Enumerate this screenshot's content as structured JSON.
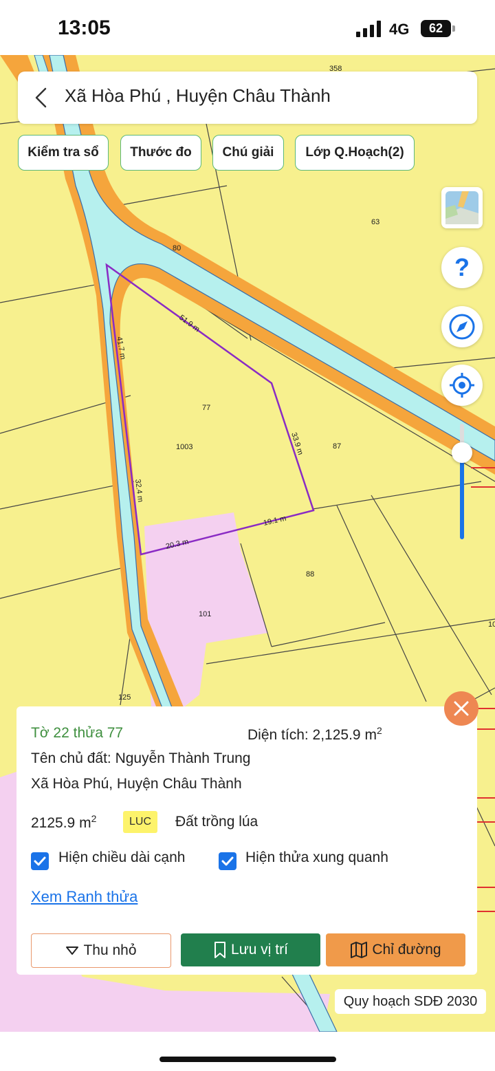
{
  "status": {
    "time": "13:05",
    "network": "4G",
    "battery": "62"
  },
  "header": {
    "title": "Xã Hòa Phú , Huyện Châu Thành"
  },
  "toolbar": {
    "buttons": [
      "Kiểm tra sổ",
      "Thước đo",
      "Chú giải",
      "Lớp Q.Hoạch(2)"
    ]
  },
  "map": {
    "parcel_numbers": [
      "358",
      "63",
      "80",
      "77",
      "1003",
      "87",
      "88",
      "101",
      "125",
      "10"
    ],
    "edge_lengths": [
      "51.9 m",
      "41.7 m",
      "33.9 m",
      "32.4 m",
      "19.1 m",
      "20.3 m"
    ],
    "colors": {
      "base": "#f7f08e",
      "river": "#b6f0ee",
      "bank": "#f5a53c",
      "pink_zone": "#f4d0f0",
      "boundary": "#8a2bc4"
    },
    "zoom_level_fraction": 0.75,
    "icons": [
      "layers-icon",
      "help-icon",
      "compass-icon",
      "locate-icon"
    ]
  },
  "panel": {
    "parcel": "Tờ 22 thửa 77",
    "area_label": "Diện tích: 2,125.9 m",
    "area_sup": "2",
    "owner": "Tên chủ đất: Nguyễn Thành Trung",
    "address": "Xã Hòa Phú, Huyện Châu Thành",
    "area_value": "2125.9 m",
    "land_code": "LUC",
    "land_type": "Đất trồng lúa",
    "check_edge": "Hiện chiều dài cạnh",
    "check_neighbors": "Hiện thửa xung quanh",
    "link": "Xem Ranh thửa",
    "btn_minimize": "Thu nhỏ",
    "btn_save": "Lưu vị trí",
    "btn_directions": "Chỉ đường"
  },
  "plan_label": "Quy hoạch SDĐ 2030"
}
